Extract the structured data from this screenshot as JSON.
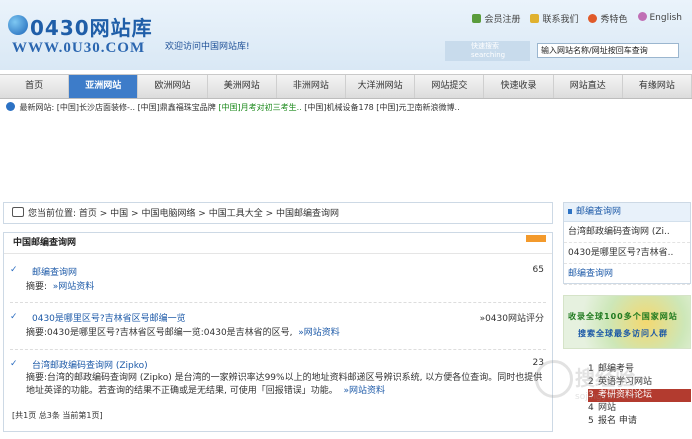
{
  "header": {
    "logo_cn": "0430网站库",
    "logo_en": "WWW.0U30.COM",
    "welcome": "欢迎访问中国网站库!",
    "toplinks": [
      "会员注册",
      "联系我们",
      "秀特色",
      "English"
    ],
    "search_label_cn": "快速搜索",
    "search_label_en": "searching",
    "search_placeholder": "输入网站名称/网址按回车查询"
  },
  "nav": [
    "首页",
    "亚洲网站",
    "欧洲网站",
    "美洲网站",
    "非洲网站",
    "大洋洲网站",
    "网站提交",
    "快速收录",
    "网站直达",
    "有缘网站"
  ],
  "news": {
    "label": "最新网站:",
    "items": [
      {
        "text": "[中国]长沙店面装修-..",
        "green": false
      },
      {
        "text": "[中国]鼎鑫福珠宝品牌",
        "green": false
      },
      {
        "text": "[中国]月考对初三考生..",
        "green": true
      },
      {
        "text": "[中国]机械设备178",
        "green": false
      },
      {
        "text": "[中国]元卫南新浪微博..",
        "green": false
      }
    ]
  },
  "breadcrumb": {
    "prefix": "您当前位置:",
    "path": "首页 > 中国 > 中国电脑网络 > 中国工具大全 > 中国邮编查询网"
  },
  "main": {
    "heading": "中国邮编查询网",
    "entries": [
      {
        "title": "邮编查询网",
        "summary_label": "摘要:",
        "summary": "",
        "link": "»网站资料",
        "meta": "65"
      },
      {
        "title": "0430是哪里区号?吉林省区号邮编一览",
        "summary_label": "摘要:",
        "summary": "0430是哪里区号?吉林省区号邮编一览:0430是吉林省的区号,",
        "link": "»网站资料",
        "meta": "»0430网站评分"
      },
      {
        "title": "台湾邮政编码查询网 (Zipko)",
        "summary_label": "摘要:",
        "summary": "台湾的邮政编码查询网 (Zipko) 是台湾的一家辨识率达99%以上的地址资料邮递区号辨识系统, 以方便各位查询。同时也提供地址英译的功能。若查询的结果不正确或是无结果, 可使用「回报错误」功能。",
        "link": "»网站资料",
        "meta": "23"
      }
    ],
    "pagination": "[共1页 总3条 当前第1页]"
  },
  "sidebar": {
    "heading": "邮编查询网",
    "items": [
      "台湾邮政编码查询网 (Zi..",
      "0430是哪里区号?吉林省..",
      "邮编查询网"
    ],
    "banner_line1": "收录全球100多个国家网站",
    "banner_line2": "搜索全球最多访问人群",
    "ranks": [
      {
        "num": "1",
        "text": "邮编考号",
        "highlight": false
      },
      {
        "num": "2",
        "text": "英语学习网站",
        "highlight": false
      },
      {
        "num": "3",
        "text": "考研资料论坛",
        "highlight": true
      },
      {
        "num": "4",
        "text": "网站",
        "highlight": false
      },
      {
        "num": "5",
        "text": "报名 申请",
        "highlight": false
      }
    ]
  },
  "watermark": {
    "text": "搜经验",
    "url": "sojingyan.com"
  },
  "colors": {
    "brand": "#1f5ea8",
    "nav_active": "#3d7cc9",
    "rank_highlight": "#b33b2f"
  }
}
